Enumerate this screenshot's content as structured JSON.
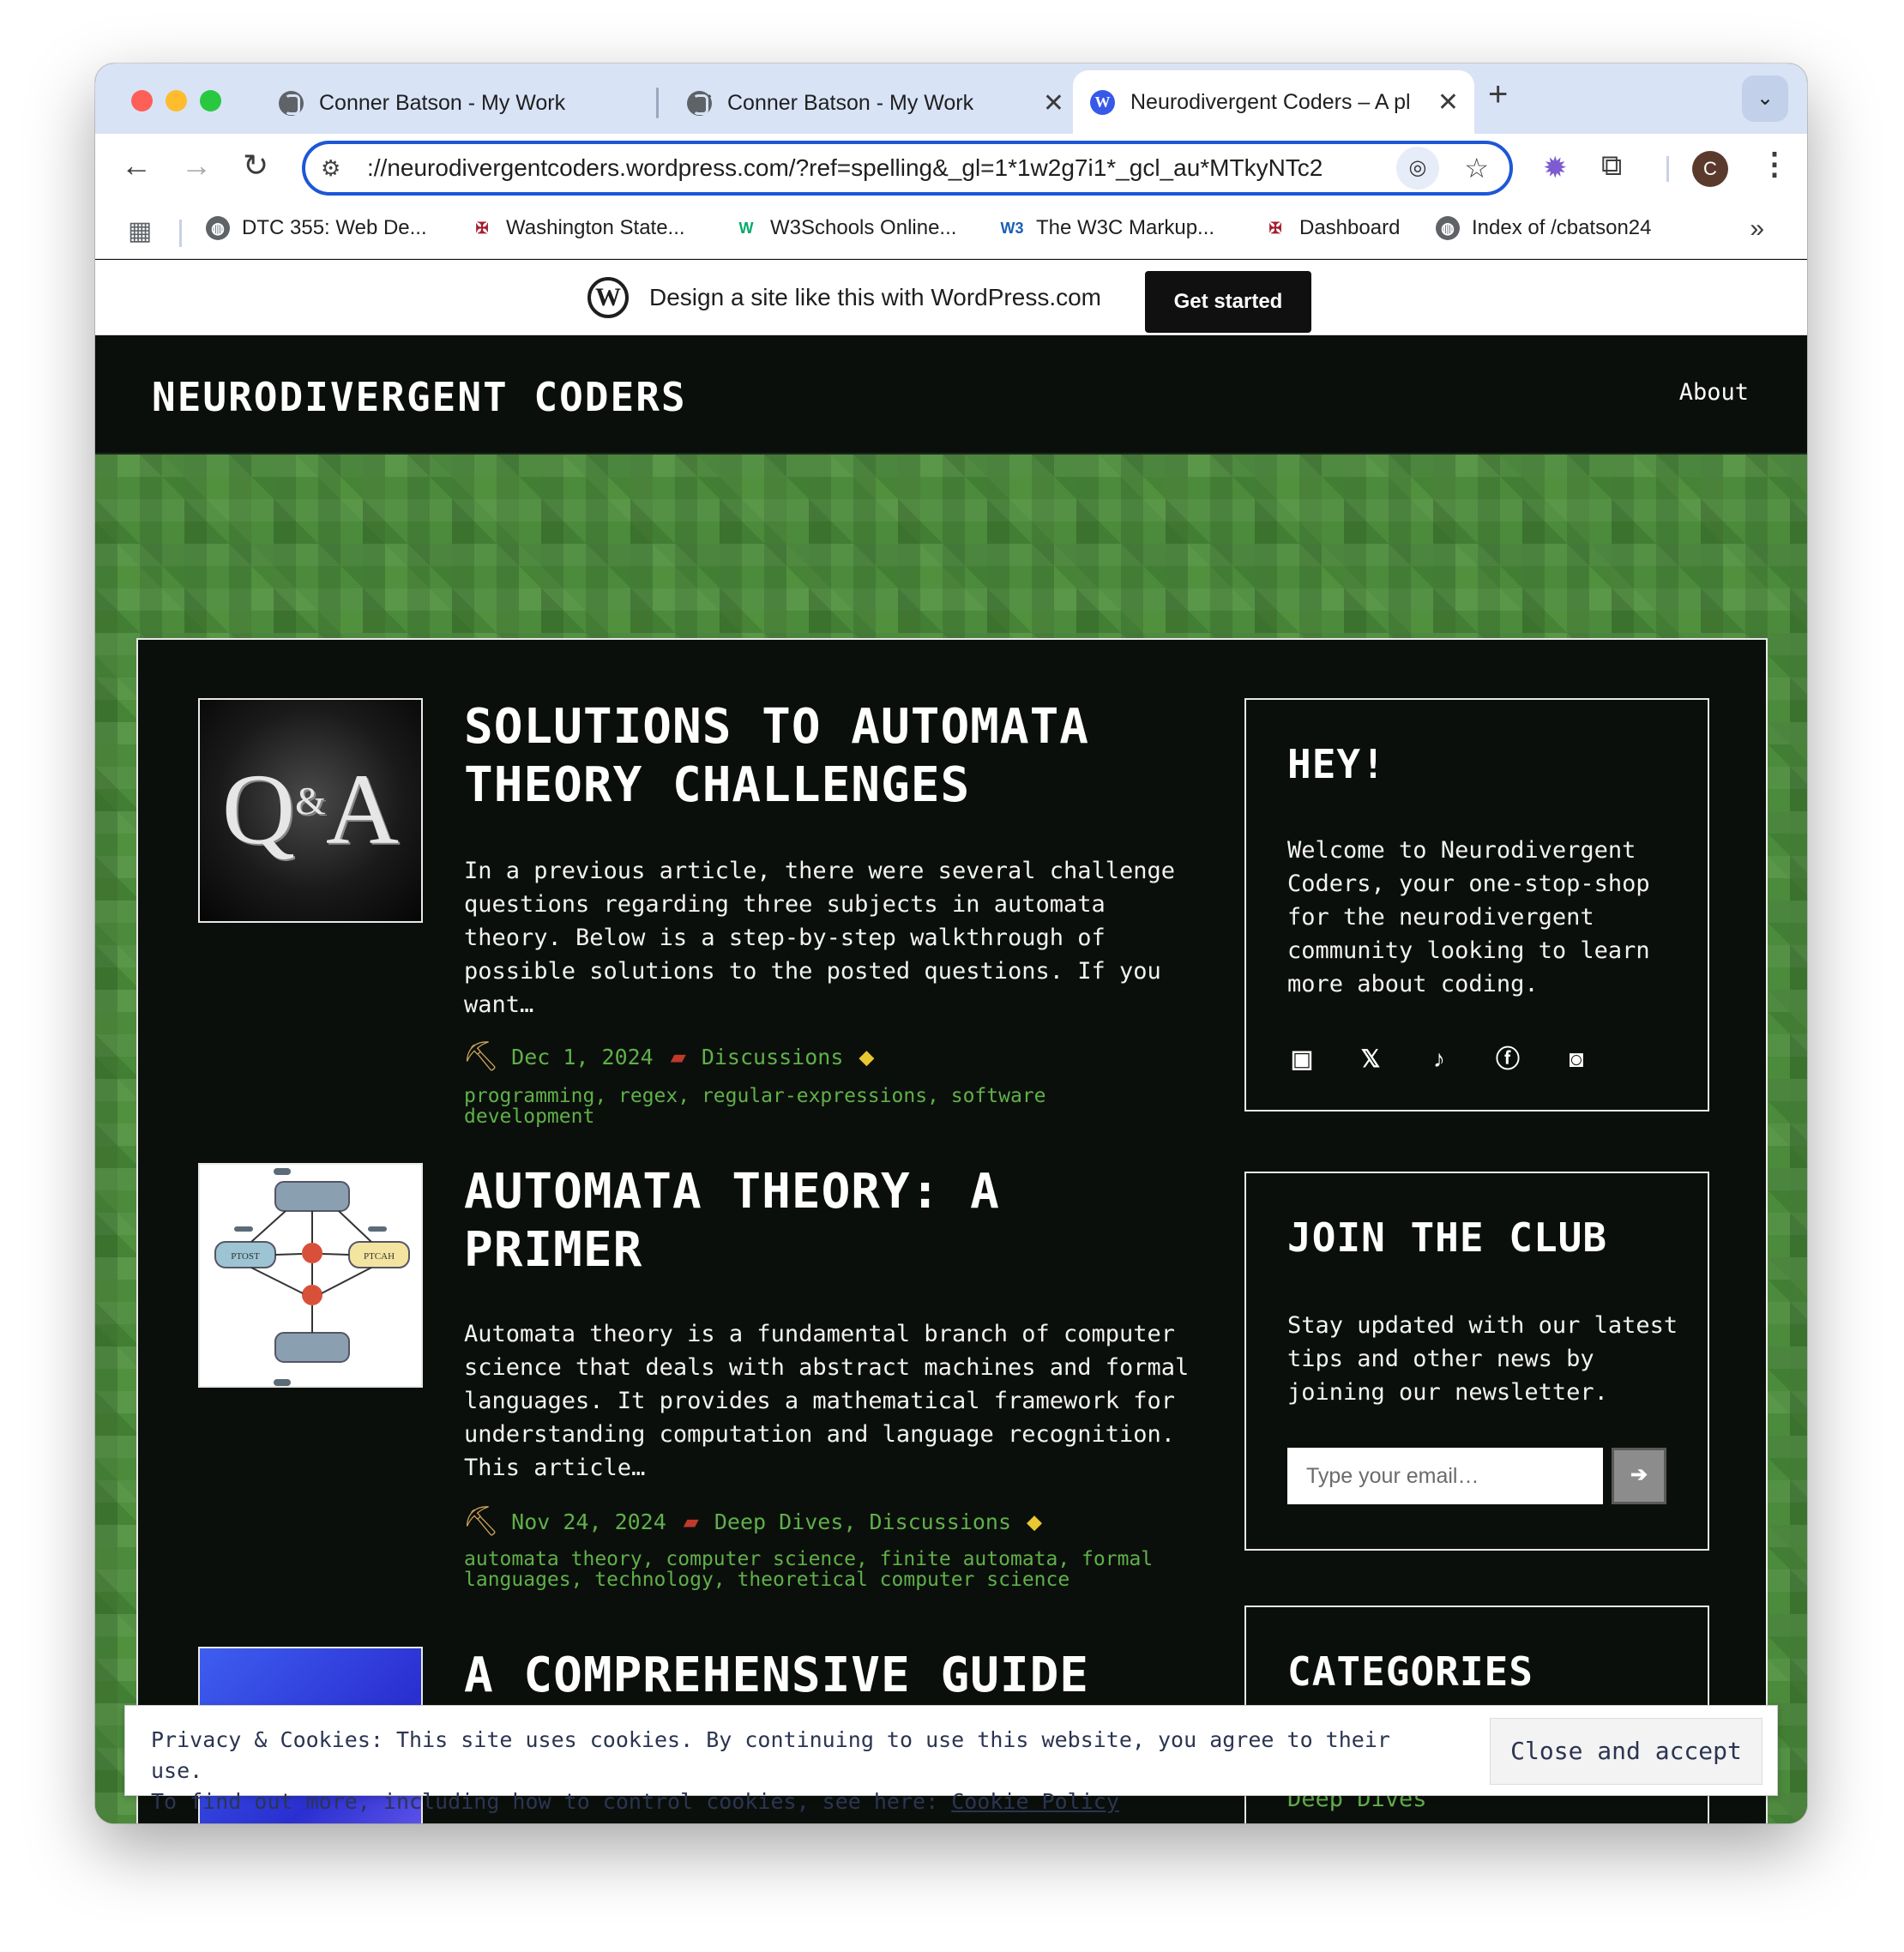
{
  "browser": {
    "tabs": [
      {
        "title": "Conner Batson - My Work",
        "active": false
      },
      {
        "title": "Conner Batson - My Work",
        "active": false
      },
      {
        "title": "Neurodivergent Coders – A pl",
        "active": true
      }
    ],
    "url": "://neurodivergentcoders.wordpress.com/?ref=spelling&_gl=1*1w2g7i1*_gcl_au*MTkyNTc2",
    "profile_initial": "C",
    "bookmarks": [
      {
        "label": "DTC 355: Web De...",
        "icon": "globe-icon"
      },
      {
        "label": "Washington State...",
        "icon": "wsu-icon"
      },
      {
        "label": "W3Schools Online...",
        "icon": "w3schools-icon"
      },
      {
        "label": "The W3C Markup...",
        "icon": "w3c-icon"
      },
      {
        "label": "Dashboard",
        "icon": "wsu-icon"
      },
      {
        "label": "Index of /cbatson24",
        "icon": "globe-icon"
      }
    ]
  },
  "wp_banner": {
    "text": "Design a site like this with WordPress.com",
    "button": "Get started"
  },
  "site": {
    "title": "NEURODIVERGENT CODERS",
    "nav": [
      "About"
    ]
  },
  "posts": [
    {
      "title": "SOLUTIONS TO AUTOMATA THEORY CHALLENGES",
      "excerpt": "In a previous article, there were several challenge questions regarding three subjects in automata theory. Below is a step-by-step walkthrough of possible solutions to the posted questions. If you want…",
      "date": "Dec 1, 2024",
      "categories": "Discussions",
      "tags": "programming, regex, regular-expressions, software development",
      "thumb_text": "Q&A"
    },
    {
      "title": "AUTOMATA THEORY: A PRIMER",
      "excerpt": "Automata theory is a fundamental branch of computer science that deals with abstract machines and formal languages. It provides a mathematical framework for understanding computation and language recognition. This article…",
      "date": "Nov 24, 2024",
      "categories": "Deep Dives, Discussions",
      "tags": "automata theory, computer science, finite automata, formal languages, technology, theoretical computer science",
      "thumb_labels": [
        "PTOST",
        "PTCAH"
      ]
    },
    {
      "title": "A COMPREHENSIVE GUIDE"
    }
  ],
  "sidebar": {
    "hey": {
      "title": "HEY!",
      "text": "Welcome to Neurodivergent Coders, your one-stop-shop for the neurodivergent community looking to learn more about coding.",
      "socials": [
        "twitch-icon",
        "x-icon",
        "tiktok-icon",
        "facebook-icon",
        "instagram-icon"
      ]
    },
    "club": {
      "title": "JOIN THE CLUB",
      "text": "Stay updated with our latest tips and other news by joining our newsletter.",
      "placeholder": "Type your email…"
    },
    "categories": {
      "title": "CATEGORIES",
      "first_item": "Deep Dives"
    }
  },
  "cookie": {
    "line1": "Privacy & Cookies: This site uses cookies. By continuing to use this website, you agree to their use.",
    "line2": "To find out more, including how to control cookies, see here:",
    "link": "Cookie Policy",
    "button": "Close and accept"
  },
  "colors": {
    "accent_blue": "#1d57d8",
    "site_bg": "#0b0f0b",
    "pixel_green": "#4b8b3b",
    "meta_green": "#5fb04a"
  }
}
